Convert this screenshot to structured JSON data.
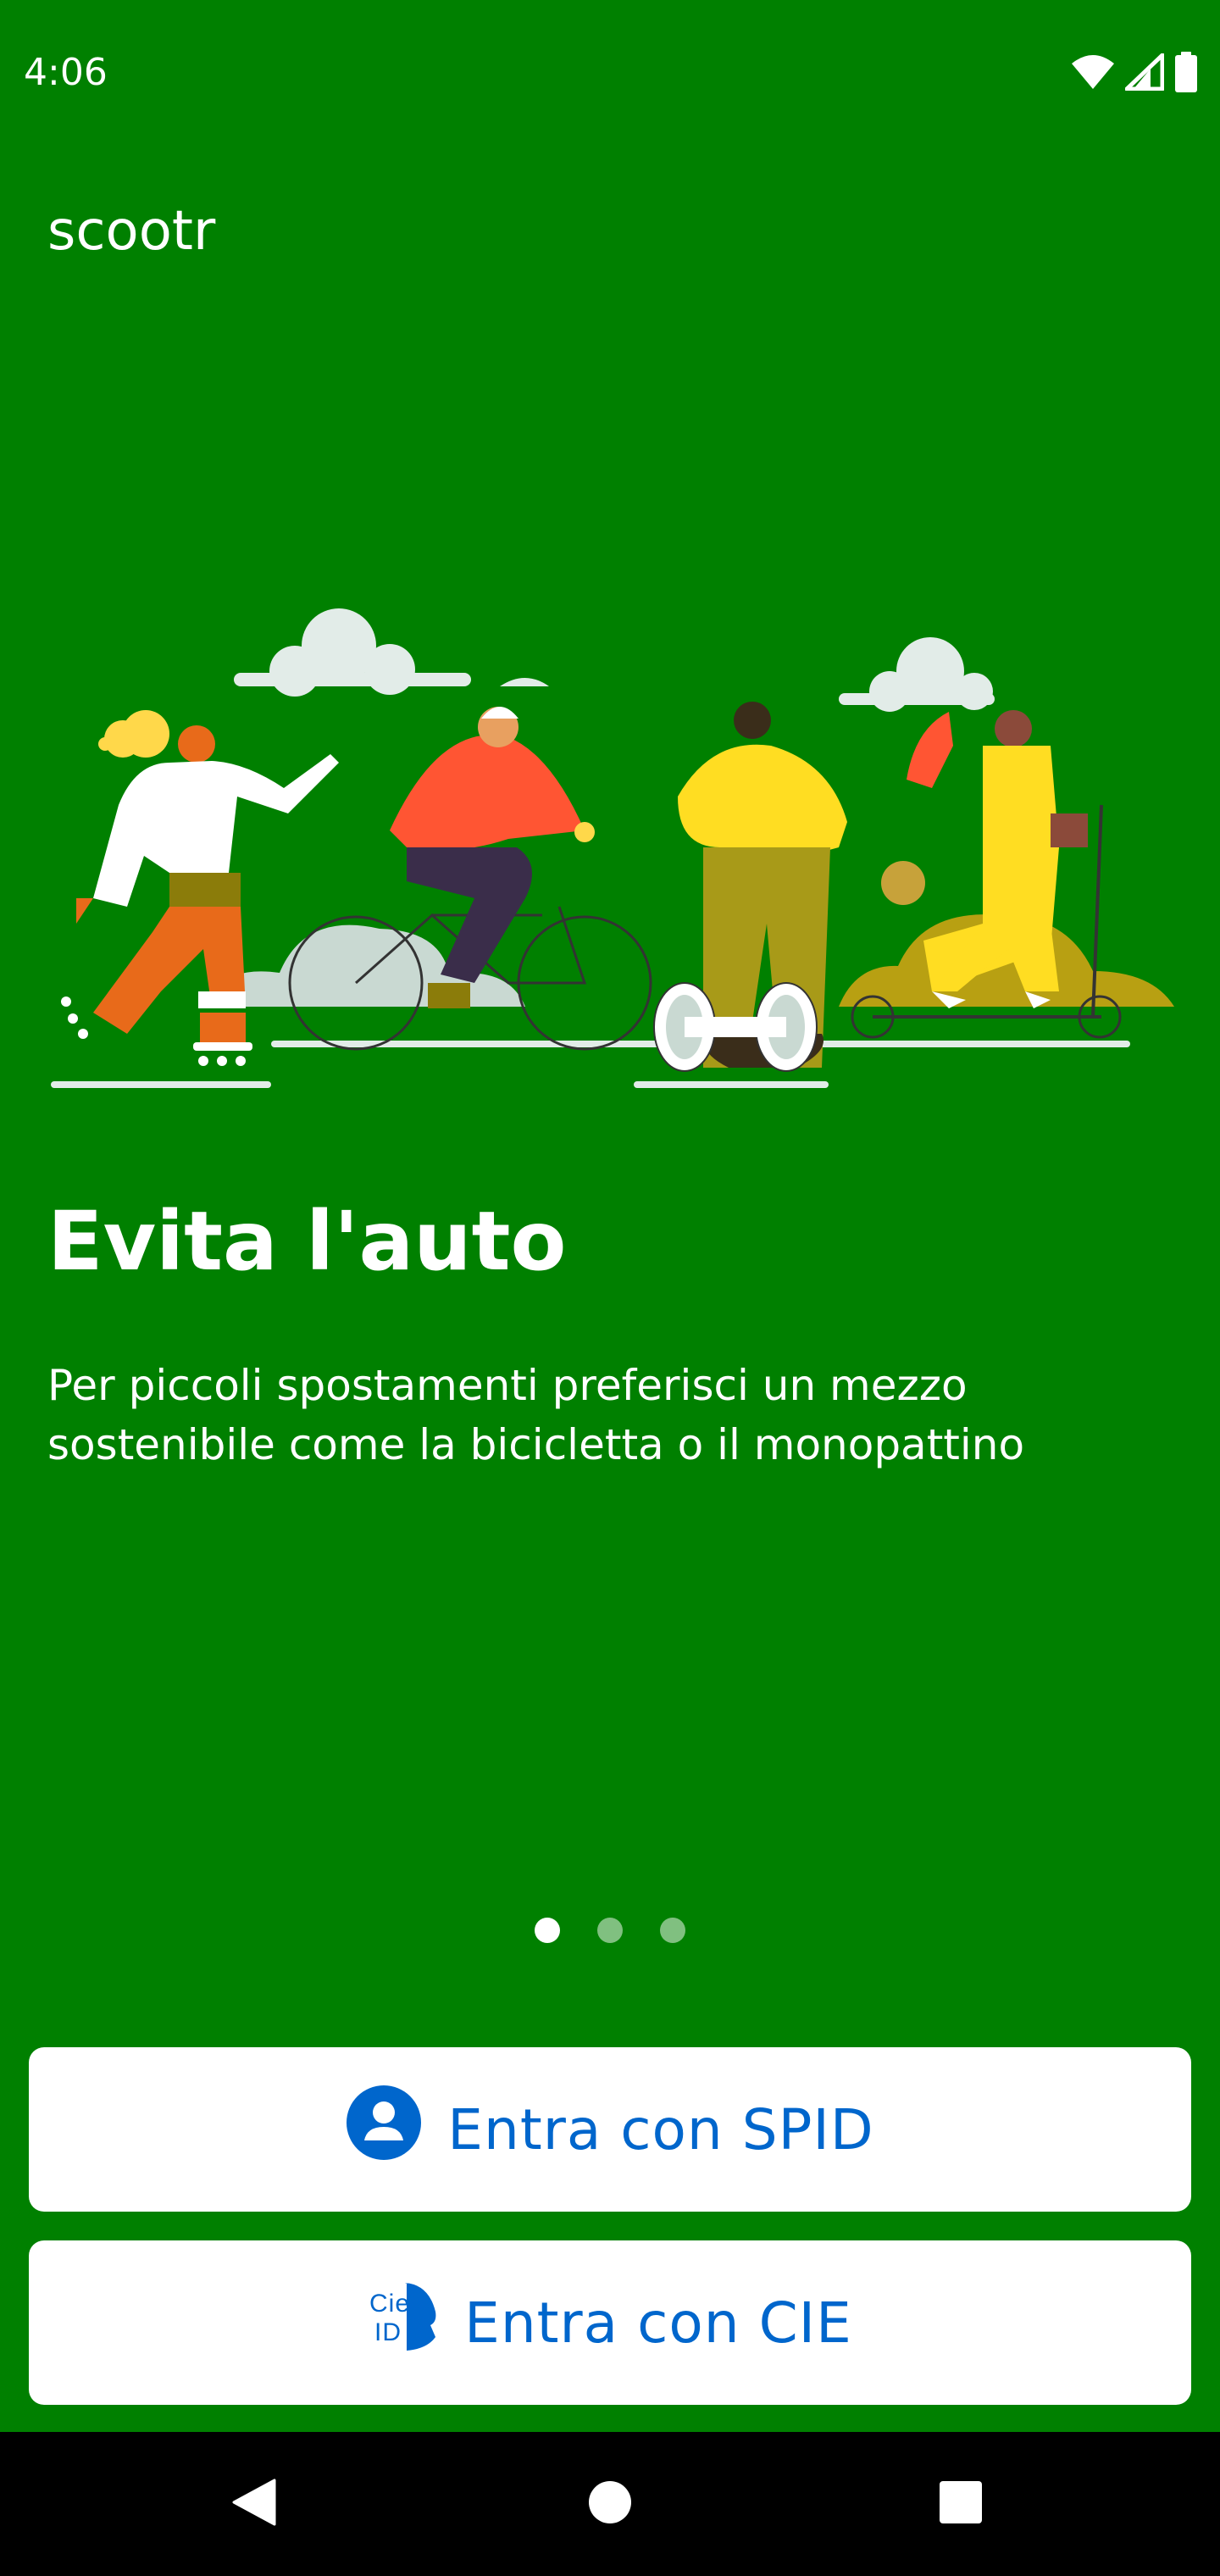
{
  "status_bar": {
    "time": "4:06",
    "icons": [
      "wifi-icon",
      "cell-signal-icon",
      "battery-icon"
    ]
  },
  "app": {
    "title": "scootr"
  },
  "slide": {
    "illustration": "people-on-sustainable-transport-illustration",
    "title": "Evita l'auto",
    "body": "Per piccoli spostamenti preferisci un mezzo sostenibile come la bicicletta o il monopattino"
  },
  "pager": {
    "count": 3,
    "active": 1
  },
  "buttons": {
    "spid_label": "Entra con SPID",
    "cie_label": "Entra con CIE",
    "cie_logo_text_top": "Cie",
    "cie_logo_text_bottom": "ID"
  },
  "nav_bar": {
    "icons": [
      "back-icon",
      "home-icon",
      "recents-icon"
    ]
  },
  "colors": {
    "background": "#008000",
    "button_text": "#0066cc",
    "button_bg": "#ffffff",
    "nav_bar": "#000000"
  }
}
